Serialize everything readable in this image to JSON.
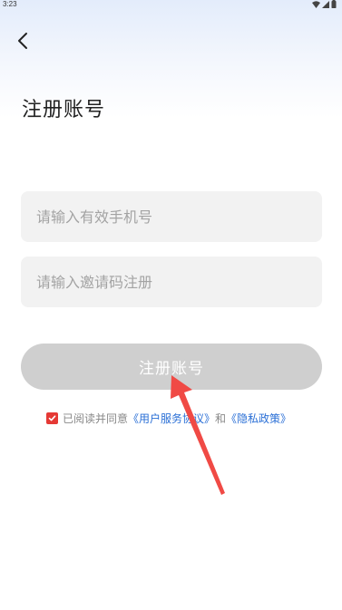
{
  "status_bar": {
    "time": "3:23"
  },
  "header": {
    "title": "注册账号"
  },
  "form": {
    "phone_placeholder": "请输入有效手机号",
    "phone_value": "",
    "invite_placeholder": "请输入邀请码注册",
    "invite_value": "",
    "register_label": "注册账号"
  },
  "agreement": {
    "checked": true,
    "prefix": "已阅读并同意",
    "user_agreement": "《用户服务协议》",
    "and": "和",
    "privacy_policy": "《隐私政策》"
  },
  "icons": {
    "back": "chevron-left-icon",
    "wifi": "wifi-icon",
    "signal": "signal-icon",
    "battery": "battery-icon",
    "check": "check-icon"
  },
  "colors": {
    "checkbox": "#e53935",
    "link": "#2a6fd6",
    "button_disabled": "#cfcfcf",
    "annotation_arrow": "#f04a45"
  }
}
